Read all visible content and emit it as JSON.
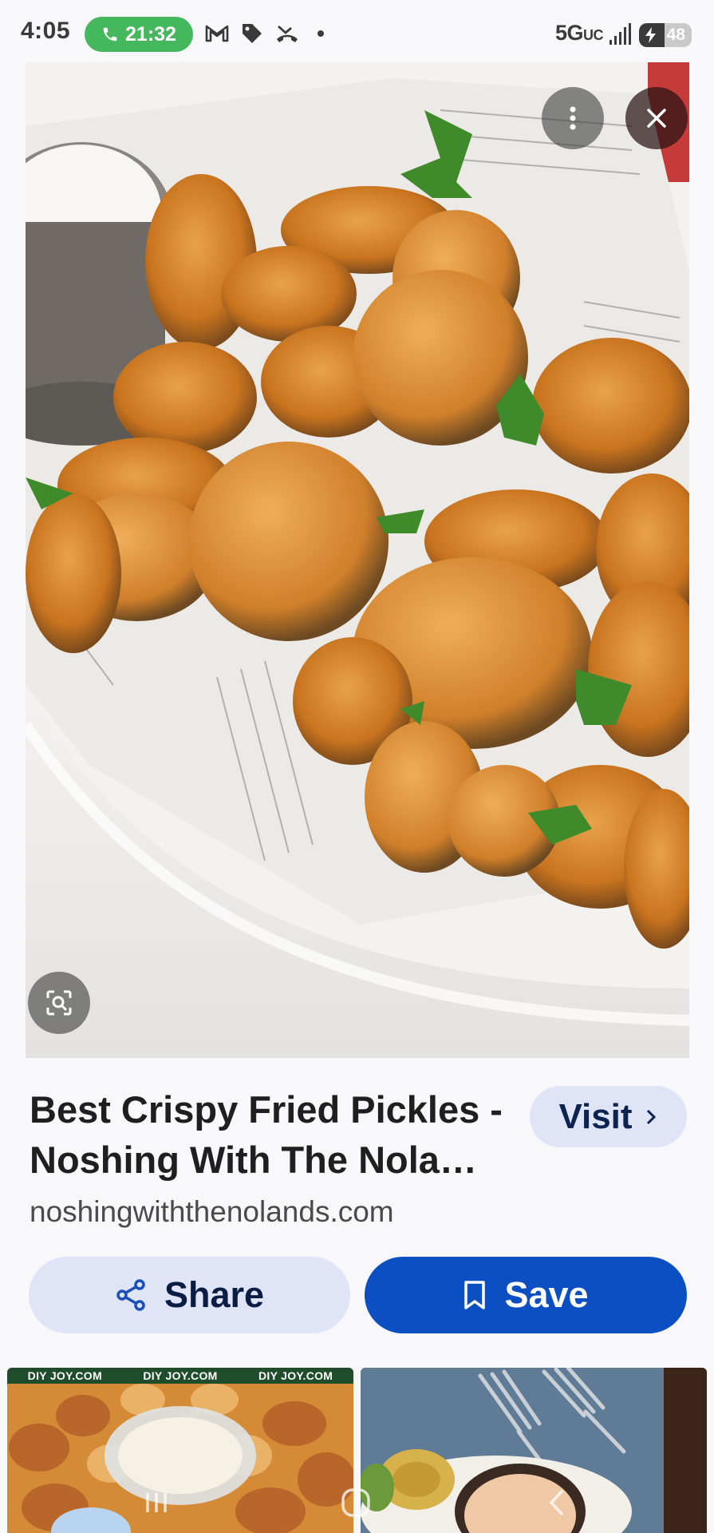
{
  "status_bar": {
    "time": "4:05",
    "call_timer": "21:32",
    "network": "5G",
    "network_suffix": "UC",
    "battery_level": "48",
    "notification_icons": [
      "gmail-icon",
      "tag-icon",
      "missed-call-icon",
      "more-dot"
    ]
  },
  "pin": {
    "title": "Best Crispy Fried Pickles - Noshing With The Nola…",
    "domain": "noshingwiththenolands.com",
    "visit_label": "Visit",
    "share_label": "Share",
    "save_label": "Save"
  },
  "hero": {
    "more_icon": "more-vertical-icon",
    "close_icon": "close-icon",
    "lens_icon": "visual-search-icon"
  },
  "related": [
    {
      "watermark": [
        "DIY JOY.COM",
        "DIY JOY.COM",
        "DIY JOY.COM"
      ]
    },
    {
      "watermark": []
    }
  ],
  "colors": {
    "accent": "#0b4fc2",
    "pill_bg": "#dfe5f7",
    "call_green": "#45b75c",
    "text_dark": "#1f1f1f"
  }
}
